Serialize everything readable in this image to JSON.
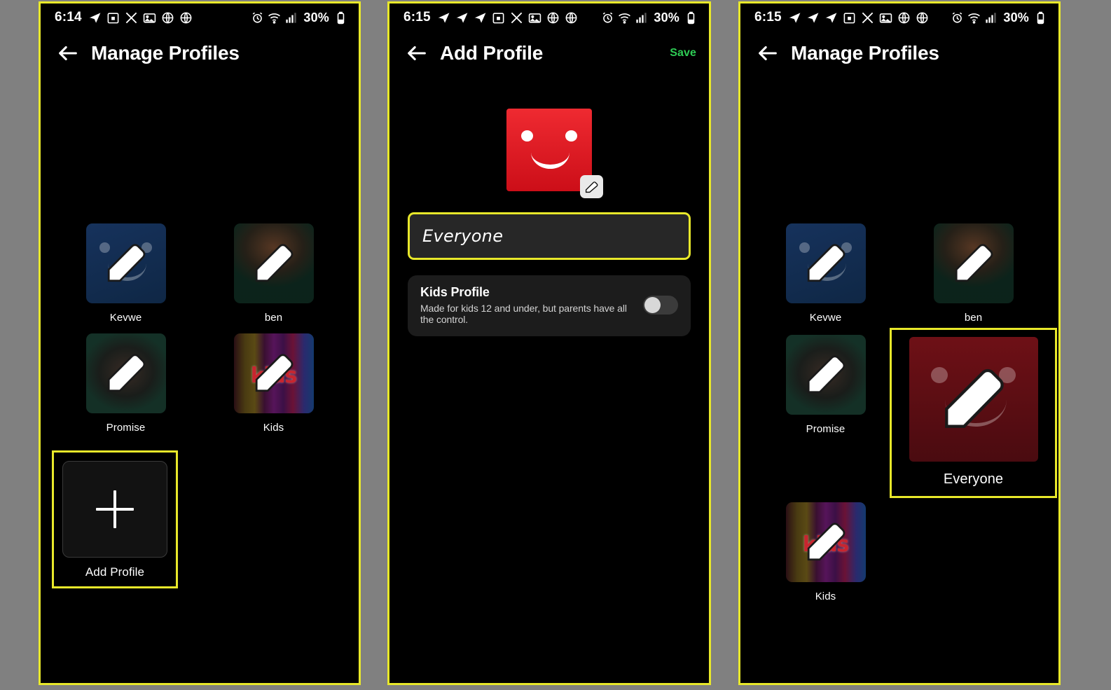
{
  "status_bar": {
    "time_panel1": "6:14",
    "time_panel2": "6:15",
    "time_panel3": "6:15",
    "battery_percent": "30%",
    "left_icons_panel1": [
      "telegram-icon",
      "calendar-icon",
      "x-twitter-icon",
      "photos-icon",
      "globe-icon",
      "globe-icon"
    ],
    "left_icons_panel2": [
      "telegram-icon",
      "telegram-icon",
      "telegram-icon",
      "calendar-icon",
      "x-twitter-icon",
      "photos-icon",
      "globe-icon",
      "globe-icon"
    ],
    "right_icons": [
      "alarm-icon",
      "wifi-icon",
      "signal-icon",
      "battery-icon"
    ]
  },
  "panel1": {
    "title": "Manage Profiles",
    "profiles": [
      {
        "name": "Kevwe",
        "avatar": "blue-smiley"
      },
      {
        "name": "ben",
        "avatar": "green-portrait"
      },
      {
        "name": "Promise",
        "avatar": "green-portrait-2"
      },
      {
        "name": "Kids",
        "avatar": "rainbow-kids"
      }
    ],
    "add_profile_label": "Add Profile"
  },
  "panel2": {
    "title": "Add Profile",
    "save_label": "Save",
    "avatar_color": "#e8232a",
    "name_value": "Everyone",
    "kids_card": {
      "title": "Kids Profile",
      "subtitle": "Made for kids 12 and under, but parents have all the control.",
      "toggle_state": "off"
    }
  },
  "panel3": {
    "title": "Manage Profiles",
    "profiles": [
      {
        "name": "Kevwe",
        "avatar": "blue-smiley"
      },
      {
        "name": "ben",
        "avatar": "green-portrait"
      },
      {
        "name": "Promise",
        "avatar": "green-portrait-2"
      },
      {
        "name": "Kids",
        "avatar": "rainbow-kids"
      }
    ],
    "highlighted_profile": {
      "name": "Everyone",
      "avatar": "red-smiley"
    }
  },
  "colors": {
    "highlight": "#e8e82a",
    "save_green": "#2ecc55",
    "background": "#000000",
    "page_background": "#808080"
  },
  "kids_wordmark": "kids"
}
